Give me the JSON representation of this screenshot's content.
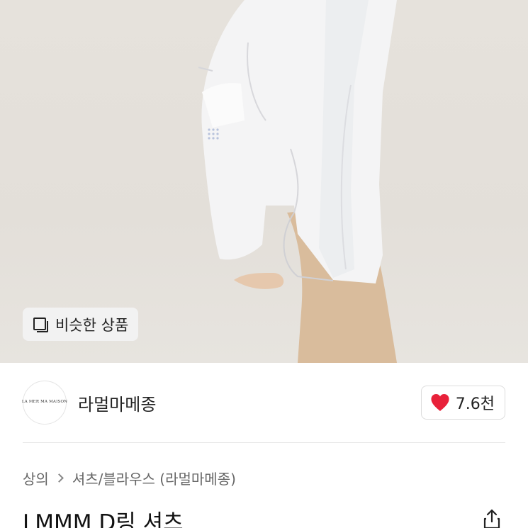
{
  "hero": {
    "similar_label": "비슷한 상품"
  },
  "brand": {
    "name": "라멀마메종",
    "logo_line1": "LA MER MA MAISON",
    "logo_line2": "",
    "like_count": "7.6천"
  },
  "breadcrumb": {
    "level1": "상의",
    "level2": "셔츠/블라우스 (라멀마메종)"
  },
  "product": {
    "title": "LMMM D링 셔츠"
  },
  "icons": {
    "similar": "similar-items-icon",
    "like": "heart-icon",
    "share": "share-icon",
    "chevron": "chevron-right-icon"
  },
  "colors": {
    "heart": "#e8213a",
    "chip_bg": "#f2f2f2"
  }
}
